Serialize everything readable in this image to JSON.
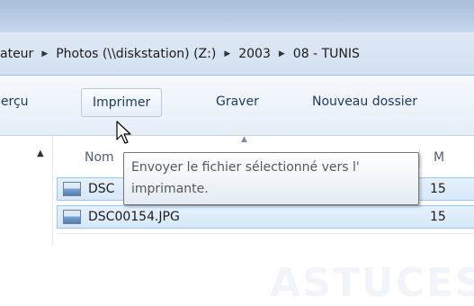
{
  "address_bar": {
    "crumbs": [
      "ateur",
      "Photos (\\\\diskstation) (Z:)",
      "2003",
      "08 - TUNIS"
    ]
  },
  "toolbar": {
    "apercu_label": "perçu",
    "imprimer_label": "Imprimer",
    "graver_label": "Graver",
    "nouveau_dossier_label": "Nouveau dossier"
  },
  "file_list": {
    "columns": {
      "name": "Nom",
      "modified": "M"
    },
    "rows": [
      {
        "name": "DSC",
        "date": "15"
      },
      {
        "name": "DSC00154.JPG",
        "date": "15"
      }
    ]
  },
  "tooltip": {
    "line1": "Envoyer le fichier sélectionné vers l'",
    "line2": "imprimante."
  },
  "colors": {
    "selection": "#d6e8fa",
    "selection_border": "#9cc4ec",
    "toolbar_text": "#1e395b"
  }
}
